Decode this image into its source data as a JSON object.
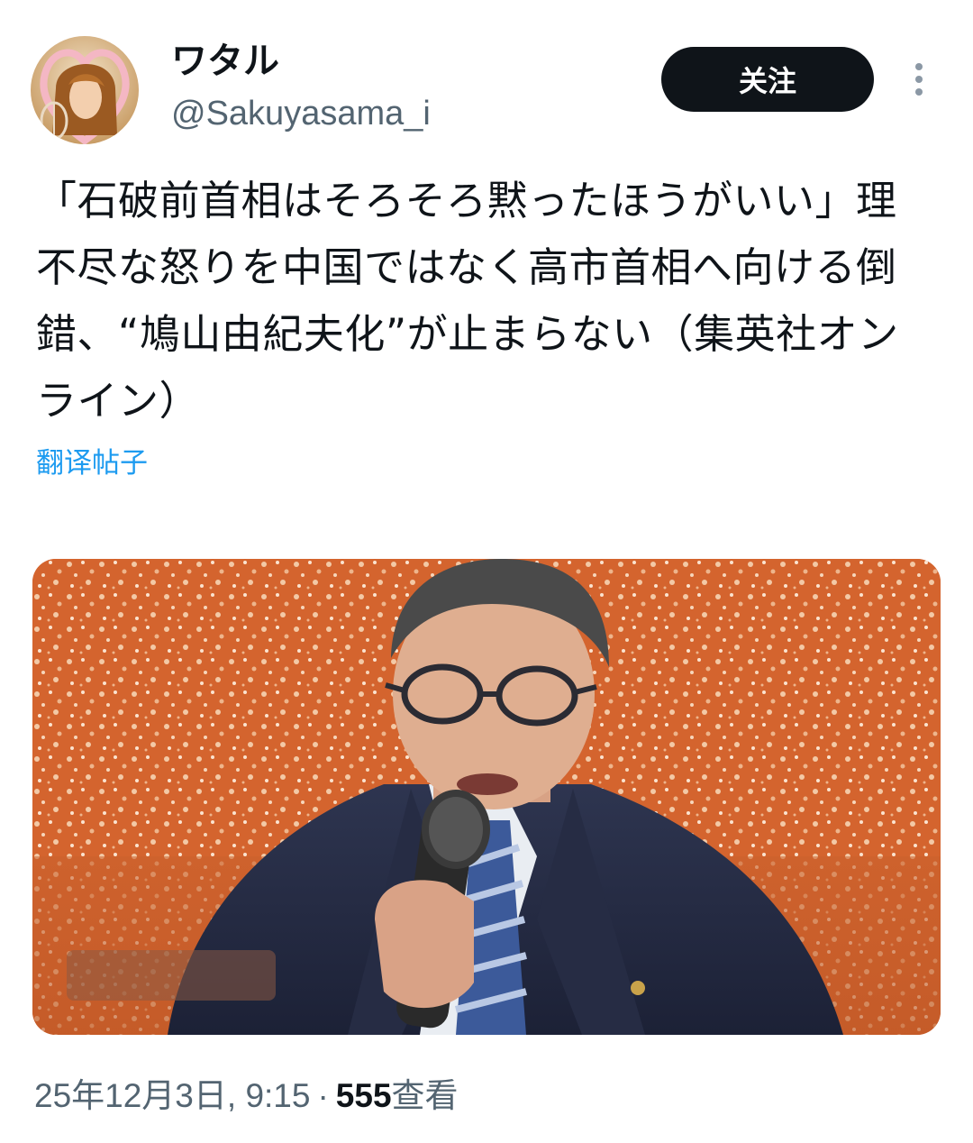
{
  "author": {
    "display_name": "ワタル",
    "handle": "@Sakuyasama_i",
    "avatar_icon": "user-avatar-photo"
  },
  "actions": {
    "follow_label": "关注",
    "more_icon": "vertical-ellipsis-icon"
  },
  "tweet": {
    "text": "「石破前首相はそろそろ黙ったほうがいい」理不尽な怒りを中国ではなく高市首相へ向ける倒錯、“鳩山由紀夫化”が止まらない（集英社オンライン）",
    "translate_label": "翻译帖子"
  },
  "media": {
    "description_icon": "photo-of-man-speaking-into-microphone"
  },
  "meta": {
    "timestamp": "25年12月3日, 9:15",
    "separator": "·",
    "views_count": "555",
    "views_label": "查看"
  },
  "colors": {
    "accent_link": "#1d9bf0",
    "button_bg": "#0f1419",
    "secondary_text": "#536471",
    "media_background": "#d56a34"
  }
}
